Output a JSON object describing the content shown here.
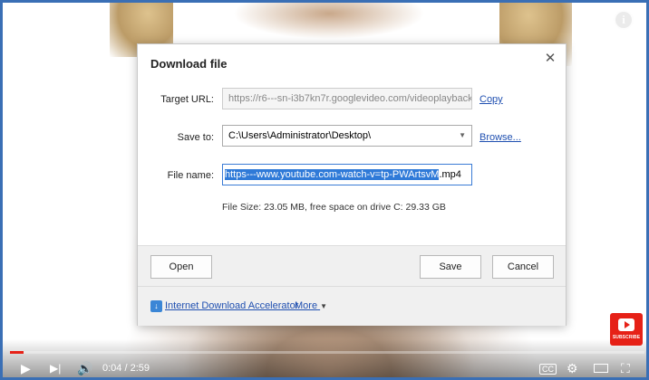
{
  "dialog": {
    "title": "Download file",
    "close_icon": "close-icon",
    "target_url_label": "Target URL:",
    "target_url_value": "https://r6---sn-i3b7kn7r.googlevideo.com/videoplayback",
    "copy_link": "Copy",
    "save_to_label": "Save to:",
    "save_to_value": "C:\\Users\\Administrator\\Desktop\\",
    "browse_link": "Browse...",
    "file_name_label": "File name:",
    "file_name_selected": "https---www.youtube.com-watch-v=tp-PWArtsvM",
    "file_name_ext": ".mp4",
    "file_size_text": "File Size: 23.05 MB, free space on drive C: 29.33 GB",
    "open_button": "Open",
    "save_button": "Save",
    "cancel_button": "Cancel",
    "footer_link": "Internet Download Accelerator",
    "more_link": "More",
    "more_caret": "▼"
  },
  "player": {
    "time_text": "0:04 / 2:59",
    "progress": 0.022,
    "subscribe_label": "SUBSCRIBE",
    "colors": {
      "progress": "#e62117",
      "accent_frame": "#3a6fb5"
    }
  }
}
